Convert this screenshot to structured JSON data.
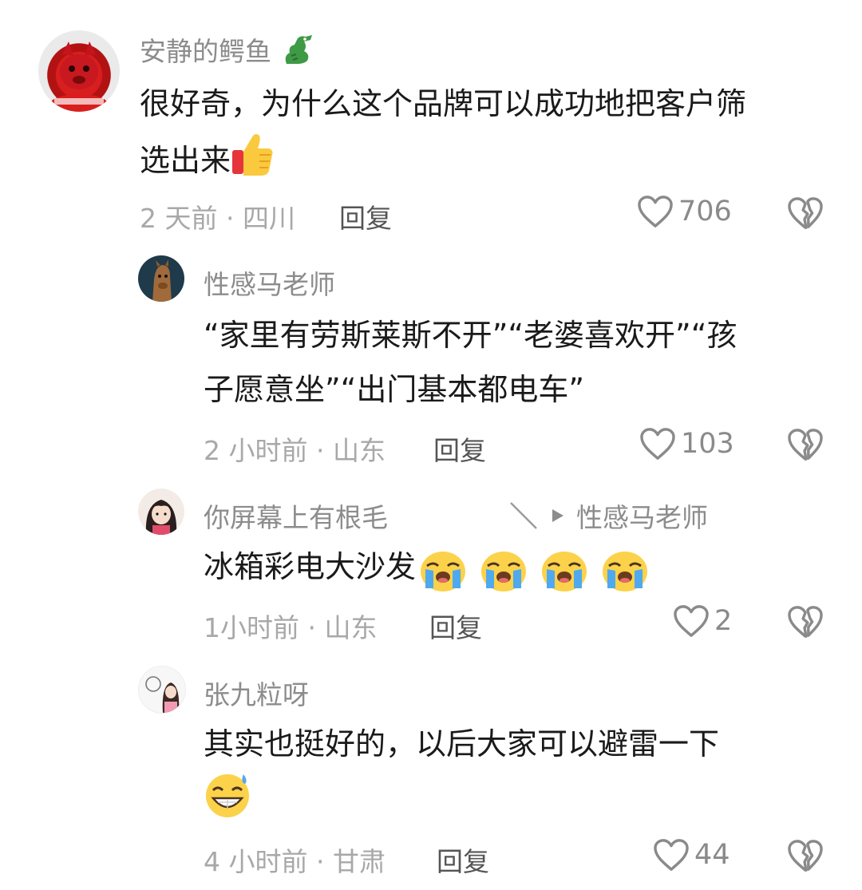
{
  "comments": [
    {
      "username": "安静的鳄鱼",
      "username_icon": "crocodile-icon",
      "line1": "很好奇，为什么这个品牌可以成功地把客户筛",
      "line2": "选出来",
      "emoji": "thumbs-up-icon",
      "meta": "2 天前 · 四川",
      "reply_label": "回复",
      "likes": "706"
    },
    {
      "username": "性感马老师",
      "line1": "“家里有劳斯莱斯不开”“老婆喜欢开”“孩",
      "line2": "子愿意坐”“出门基本都电车”",
      "meta": "2 小时前 · 山东",
      "reply_label": "回复",
      "likes": "103"
    },
    {
      "username": "你屏幕上有根毛",
      "reply_to": "性感马老师",
      "line1": "冰箱彩电大沙发",
      "emoji": "crying-face-icon",
      "meta": "1小时前 · 山东",
      "reply_label": "回复",
      "likes": "2"
    },
    {
      "username": "张九粒呀",
      "line1": "其实也挺好的，以后大家可以避雷一下",
      "emoji": "grinning-sweat-icon",
      "meta": "4 小时前 · 甘肃",
      "reply_label": "回复",
      "likes": "44"
    }
  ],
  "colors": {
    "text": "#1a1a1a",
    "muted": "#8c8c8c",
    "meta": "#a8a8a8",
    "icon": "#8a8a8a"
  }
}
